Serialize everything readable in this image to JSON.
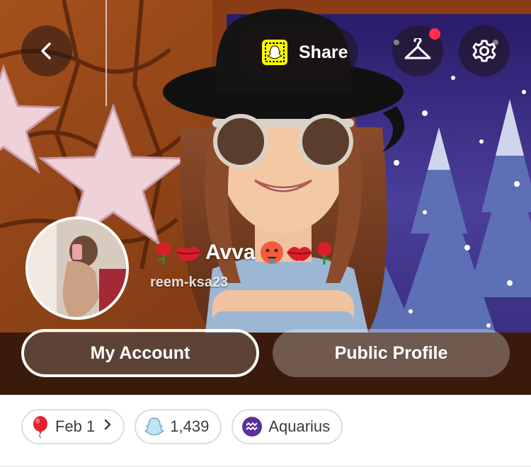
{
  "header": {
    "share_label": "Share"
  },
  "profile": {
    "display_name": "Avva",
    "username": "reem-ksa23"
  },
  "actions": {
    "my_account": "My Account",
    "public_profile": "Public Profile"
  },
  "chips": {
    "birthday": "Feb 1",
    "friends_count": "1,439",
    "zodiac": "Aquarius"
  },
  "icons": {
    "back": "chevron-left-icon",
    "snapcode": "snapcode-icon",
    "outfit": "hanger-icon",
    "settings": "gear-icon",
    "birthday": "balloon-icon",
    "friends": "ghost-icon",
    "zodiac": "aquarius-icon"
  },
  "colors": {
    "snap_yellow": "#fffc00",
    "notification": "#ff2e4d",
    "zodiac_purple": "#5b2f9e"
  }
}
